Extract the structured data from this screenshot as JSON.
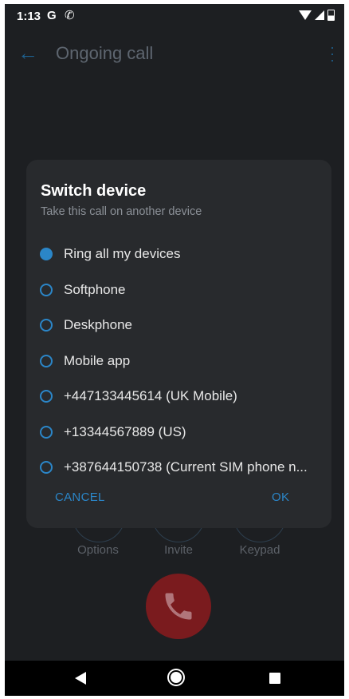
{
  "status_bar": {
    "time": "1:13",
    "icons": [
      "google-icon",
      "call-icon",
      "wifi-icon",
      "signal-icon",
      "battery-icon"
    ]
  },
  "app_bar": {
    "title": "Ongoing call",
    "back_icon": "back-arrow-icon",
    "menu_icon": "more-vertical-icon"
  },
  "call_controls": [
    {
      "label": "Options"
    },
    {
      "label": "Invite"
    },
    {
      "label": "Keypad"
    }
  ],
  "hangup": {
    "icon": "phone-hangup-icon",
    "color": "#7a1b1e"
  },
  "dialog": {
    "title": "Switch device",
    "subtitle": "Take this call on another device",
    "options": [
      {
        "label": "Ring all my devices",
        "checked": true
      },
      {
        "label": "Softphone",
        "checked": false
      },
      {
        "label": "Deskphone",
        "checked": false
      },
      {
        "label": "Mobile app",
        "checked": false
      },
      {
        "label": "+447133445614 (UK Mobile)",
        "checked": false
      },
      {
        "label": "+13344567889 (US)",
        "checked": false
      },
      {
        "label": "+387644150738 (Current SIM phone n...",
        "checked": false
      }
    ],
    "cancel_label": "CANCEL",
    "ok_label": "OK"
  },
  "colors": {
    "accent": "#2b86c8",
    "background": "#1d1f22",
    "dialog": "#282a2d"
  }
}
